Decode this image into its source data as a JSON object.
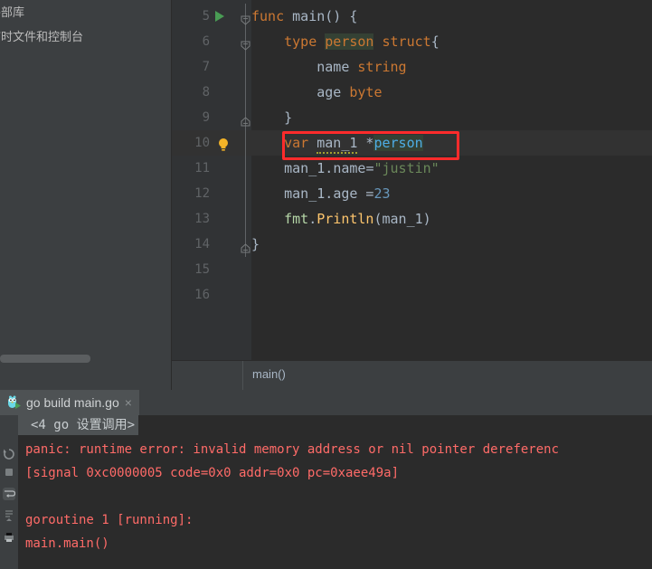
{
  "sidebar": {
    "items": [
      {
        "label": "外部库",
        "icon": "library-icon"
      },
      {
        "label": "临时文件和控制台",
        "icon": "scratches-icon"
      }
    ]
  },
  "editor": {
    "breadcrumb": "main()",
    "first_visible_line": 5,
    "current_line": 10,
    "lines": [
      {
        "num": 5,
        "has_run_arrow": true,
        "fold": "open",
        "indent": 0
      },
      {
        "num": 6,
        "has_run_arrow": false,
        "fold": "open",
        "indent": 1
      },
      {
        "num": 7,
        "has_run_arrow": false,
        "fold": "none",
        "indent": 2
      },
      {
        "num": 8,
        "has_run_arrow": false,
        "fold": "none",
        "indent": 2
      },
      {
        "num": 9,
        "has_run_arrow": false,
        "fold": "end",
        "indent": 1
      },
      {
        "num": 10,
        "has_run_arrow": false,
        "fold": "none",
        "indent": 1,
        "has_bulb": true
      },
      {
        "num": 11,
        "has_run_arrow": false,
        "fold": "none",
        "indent": 1
      },
      {
        "num": 12,
        "has_run_arrow": false,
        "fold": "none",
        "indent": 1
      },
      {
        "num": 13,
        "has_run_arrow": false,
        "fold": "none",
        "indent": 1
      },
      {
        "num": 14,
        "has_run_arrow": false,
        "fold": "end",
        "indent": 0
      },
      {
        "num": 15,
        "has_run_arrow": false,
        "fold": "none",
        "indent": 0
      },
      {
        "num": 16,
        "has_run_arrow": false,
        "fold": "none",
        "indent": 0
      }
    ],
    "source_lines": [
      "func main() {",
      "    type person struct{",
      "        name string",
      "        age byte",
      "    }",
      "    var man_1 *person",
      "    man_1.name=\"justin\"",
      "    man_1.age =23",
      "    fmt.Println(man_1)",
      "}",
      "",
      ""
    ],
    "annotation": {
      "shape": "rectangle",
      "color": "#ff2b2b",
      "target_text": "var man_1 *person",
      "target_line": 10
    }
  },
  "run_window": {
    "tab": {
      "label": "go build main.go",
      "icon": "go-gopher-icon",
      "close_label": "×"
    },
    "toolbar_icons": [
      "rerun-icon",
      "stop-icon",
      "soft-wrap-icon",
      "scroll-to-end-icon",
      "print-icon"
    ],
    "console": {
      "collapsed_frame": "<4 go 设置调用>",
      "lines": [
        "panic: runtime error: invalid memory address or nil pointer dereferenc",
        "[signal 0xc0000005 code=0x0 addr=0x0 pc=0xaee49a]",
        "",
        "goroutine 1 [running]:",
        "main.main()"
      ]
    }
  },
  "colors": {
    "editor_background": "#2b2b2b",
    "gutter_background": "#313335",
    "panel_background": "#3c3f41",
    "keyword": "#cc7832",
    "type": "#4eade5",
    "string": "#6a8759",
    "number": "#6897bb",
    "function": "#ffc66d",
    "default_text": "#a9b7c6",
    "error_text": "#ff6b68",
    "annotation": "#ff2b2b",
    "run_green": "#499c54",
    "bulb_yellow": "#f5b427"
  }
}
